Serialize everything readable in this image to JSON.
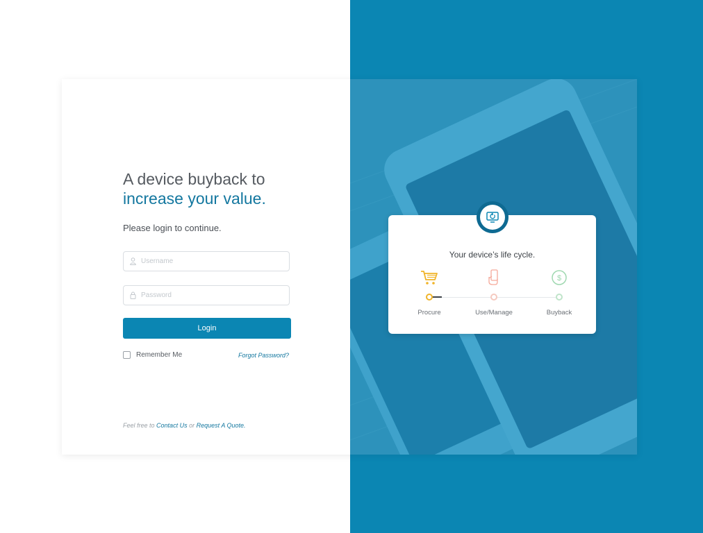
{
  "headline": {
    "line1": "A device buyback to",
    "line2_accent": "increase your value",
    "line2_end": "."
  },
  "subtitle": "Please login to continue.",
  "form": {
    "username_placeholder": "Username",
    "password_placeholder": "Password",
    "login_label": "Login",
    "remember_label": "Remember Me",
    "forgot_label": "Forgot Password?"
  },
  "footer": {
    "prefix": "Feel free to",
    "contact": "Contact Us",
    "or": "or",
    "quote": "Request A Quote."
  },
  "lifecycle": {
    "title": "Your device’s life cycle.",
    "steps": [
      {
        "label": "Procure",
        "icon": "cart-icon",
        "color": "#f0b429"
      },
      {
        "label": "Use/Manage",
        "icon": "hand-phone-icon",
        "color": "#f5a99a"
      },
      {
        "label": "Buyback",
        "icon": "dollar-coin-icon",
        "color": "#9fd8b0"
      }
    ],
    "badge_icon": "monitor-refresh-icon"
  },
  "colors": {
    "brand_blue": "#0b86b3",
    "accent_text": "#13779f"
  }
}
